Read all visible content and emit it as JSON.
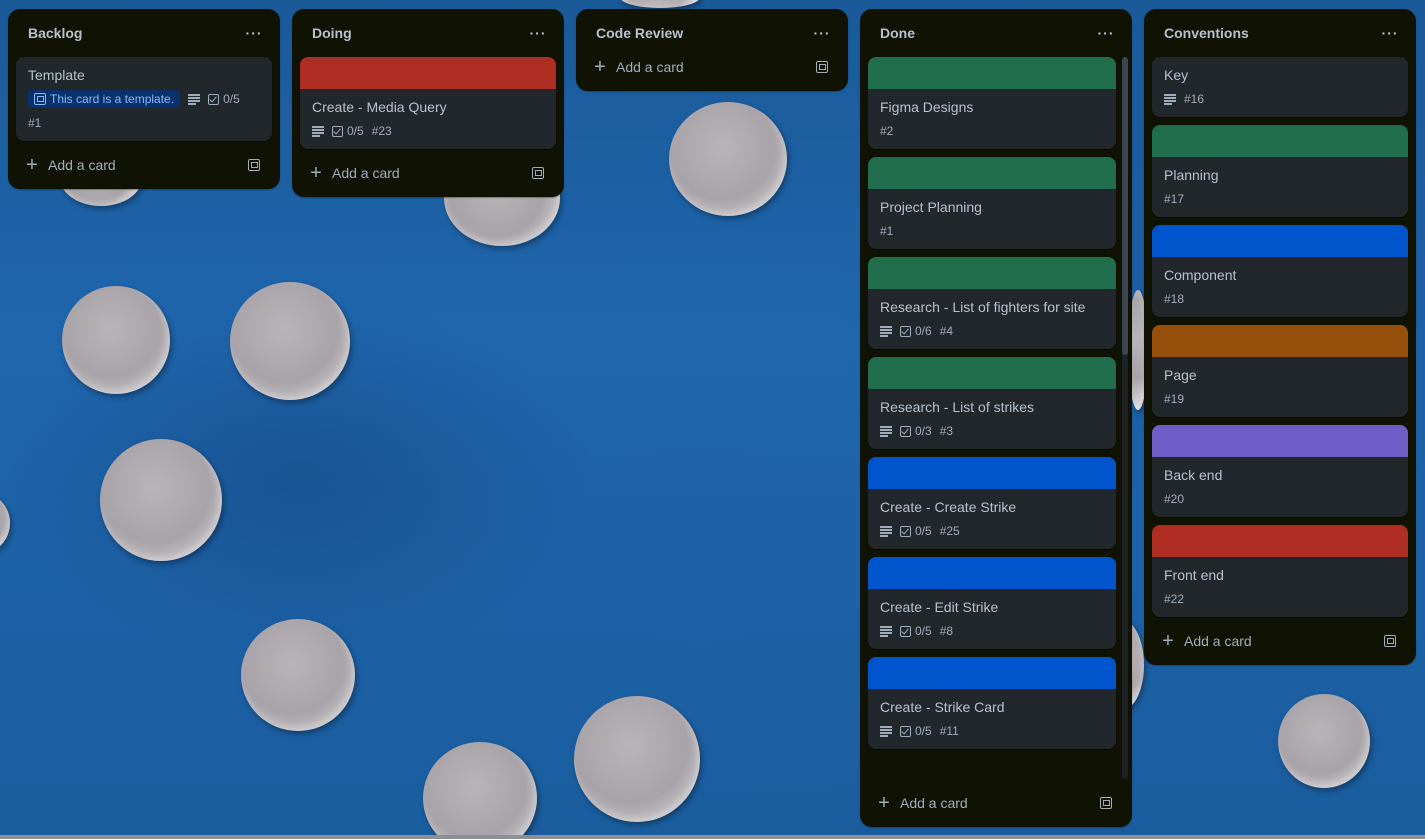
{
  "colors": {
    "list_bg": "#101204",
    "card_bg": "#22272b",
    "green": "#216e4e",
    "red": "#ae2e24",
    "blue": "#0055cc",
    "orange": "#974f0c",
    "purple": "#6e5dc6",
    "template_badge": "#09326c"
  },
  "lists": [
    {
      "title": "Backlog",
      "add_label": "Add a card",
      "cards": [
        {
          "title": "Template",
          "template_label": "This card is a template.",
          "checklist": "0/5",
          "number": "#1"
        }
      ]
    },
    {
      "title": "Doing",
      "add_label": "Add a card",
      "cards": [
        {
          "title": "Create - Media Query",
          "cover": "red",
          "checklist": "0/5",
          "number": "#23"
        }
      ]
    },
    {
      "title": "Code Review",
      "add_label": "Add a card",
      "cards": []
    },
    {
      "title": "Done",
      "add_label": "Add a card",
      "cards": [
        {
          "title": "Figma Designs",
          "cover": "green",
          "number": "#2"
        },
        {
          "title": "Project Planning",
          "cover": "green",
          "number": "#1"
        },
        {
          "title": "Research - List of fighters for site",
          "cover": "green",
          "checklist": "0/6",
          "number": "#4"
        },
        {
          "title": "Research - List of strikes",
          "cover": "green",
          "checklist": "0/3",
          "number": "#3"
        },
        {
          "title": "Create - Create Strike",
          "cover": "blue",
          "checklist": "0/5",
          "number": "#25"
        },
        {
          "title": "Create - Edit Strike",
          "cover": "blue",
          "checklist": "0/5",
          "number": "#8"
        },
        {
          "title": "Create - Strike Card",
          "cover": "blue",
          "checklist": "0/5",
          "number": "#11"
        }
      ]
    },
    {
      "title": "Conventions",
      "add_label": "Add a card",
      "cards": [
        {
          "title": "Key",
          "number": "#16"
        },
        {
          "title": "Planning",
          "cover": "green",
          "number": "#17"
        },
        {
          "title": "Component",
          "cover": "blue",
          "number": "#18"
        },
        {
          "title": "Page",
          "cover": "orange",
          "number": "#19"
        },
        {
          "title": "Back end",
          "cover": "purple",
          "number": "#20"
        },
        {
          "title": "Front end",
          "cover": "red",
          "number": "#22"
        }
      ]
    }
  ]
}
